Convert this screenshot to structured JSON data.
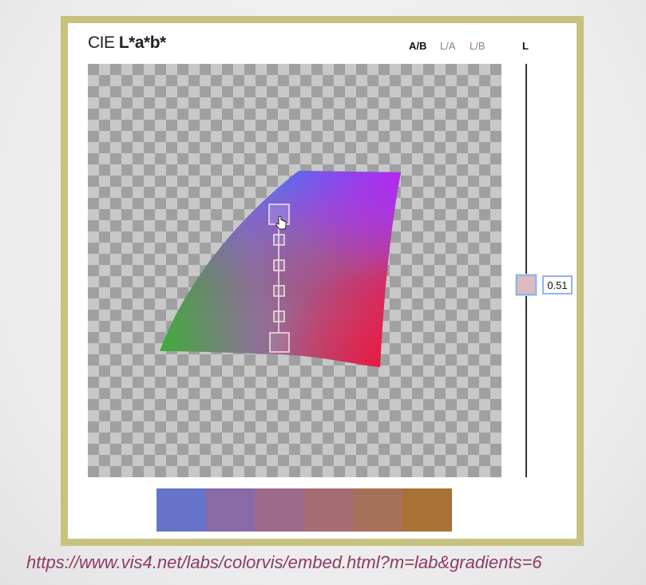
{
  "title": {
    "prefix": "CIE",
    "main": "L*a*b*"
  },
  "tabs": [
    {
      "label": "A/B",
      "active": true
    },
    {
      "label": "L/A",
      "active": false
    },
    {
      "label": "L/B",
      "active": false
    }
  ],
  "slider": {
    "axis_label": "L",
    "value": "0.51",
    "handle_color": "#dcbcc1"
  },
  "gradient": {
    "swatches": [
      "#6574c9",
      "#8a6aa6",
      "#9c6a8b",
      "#a56d73",
      "#a77059",
      "#a87234"
    ]
  },
  "icons": {
    "cursor": "hand-pointer-icon"
  },
  "url": "https://www.vis4.net/labs/colorvis/embed.html?m=lab&gradients=6"
}
